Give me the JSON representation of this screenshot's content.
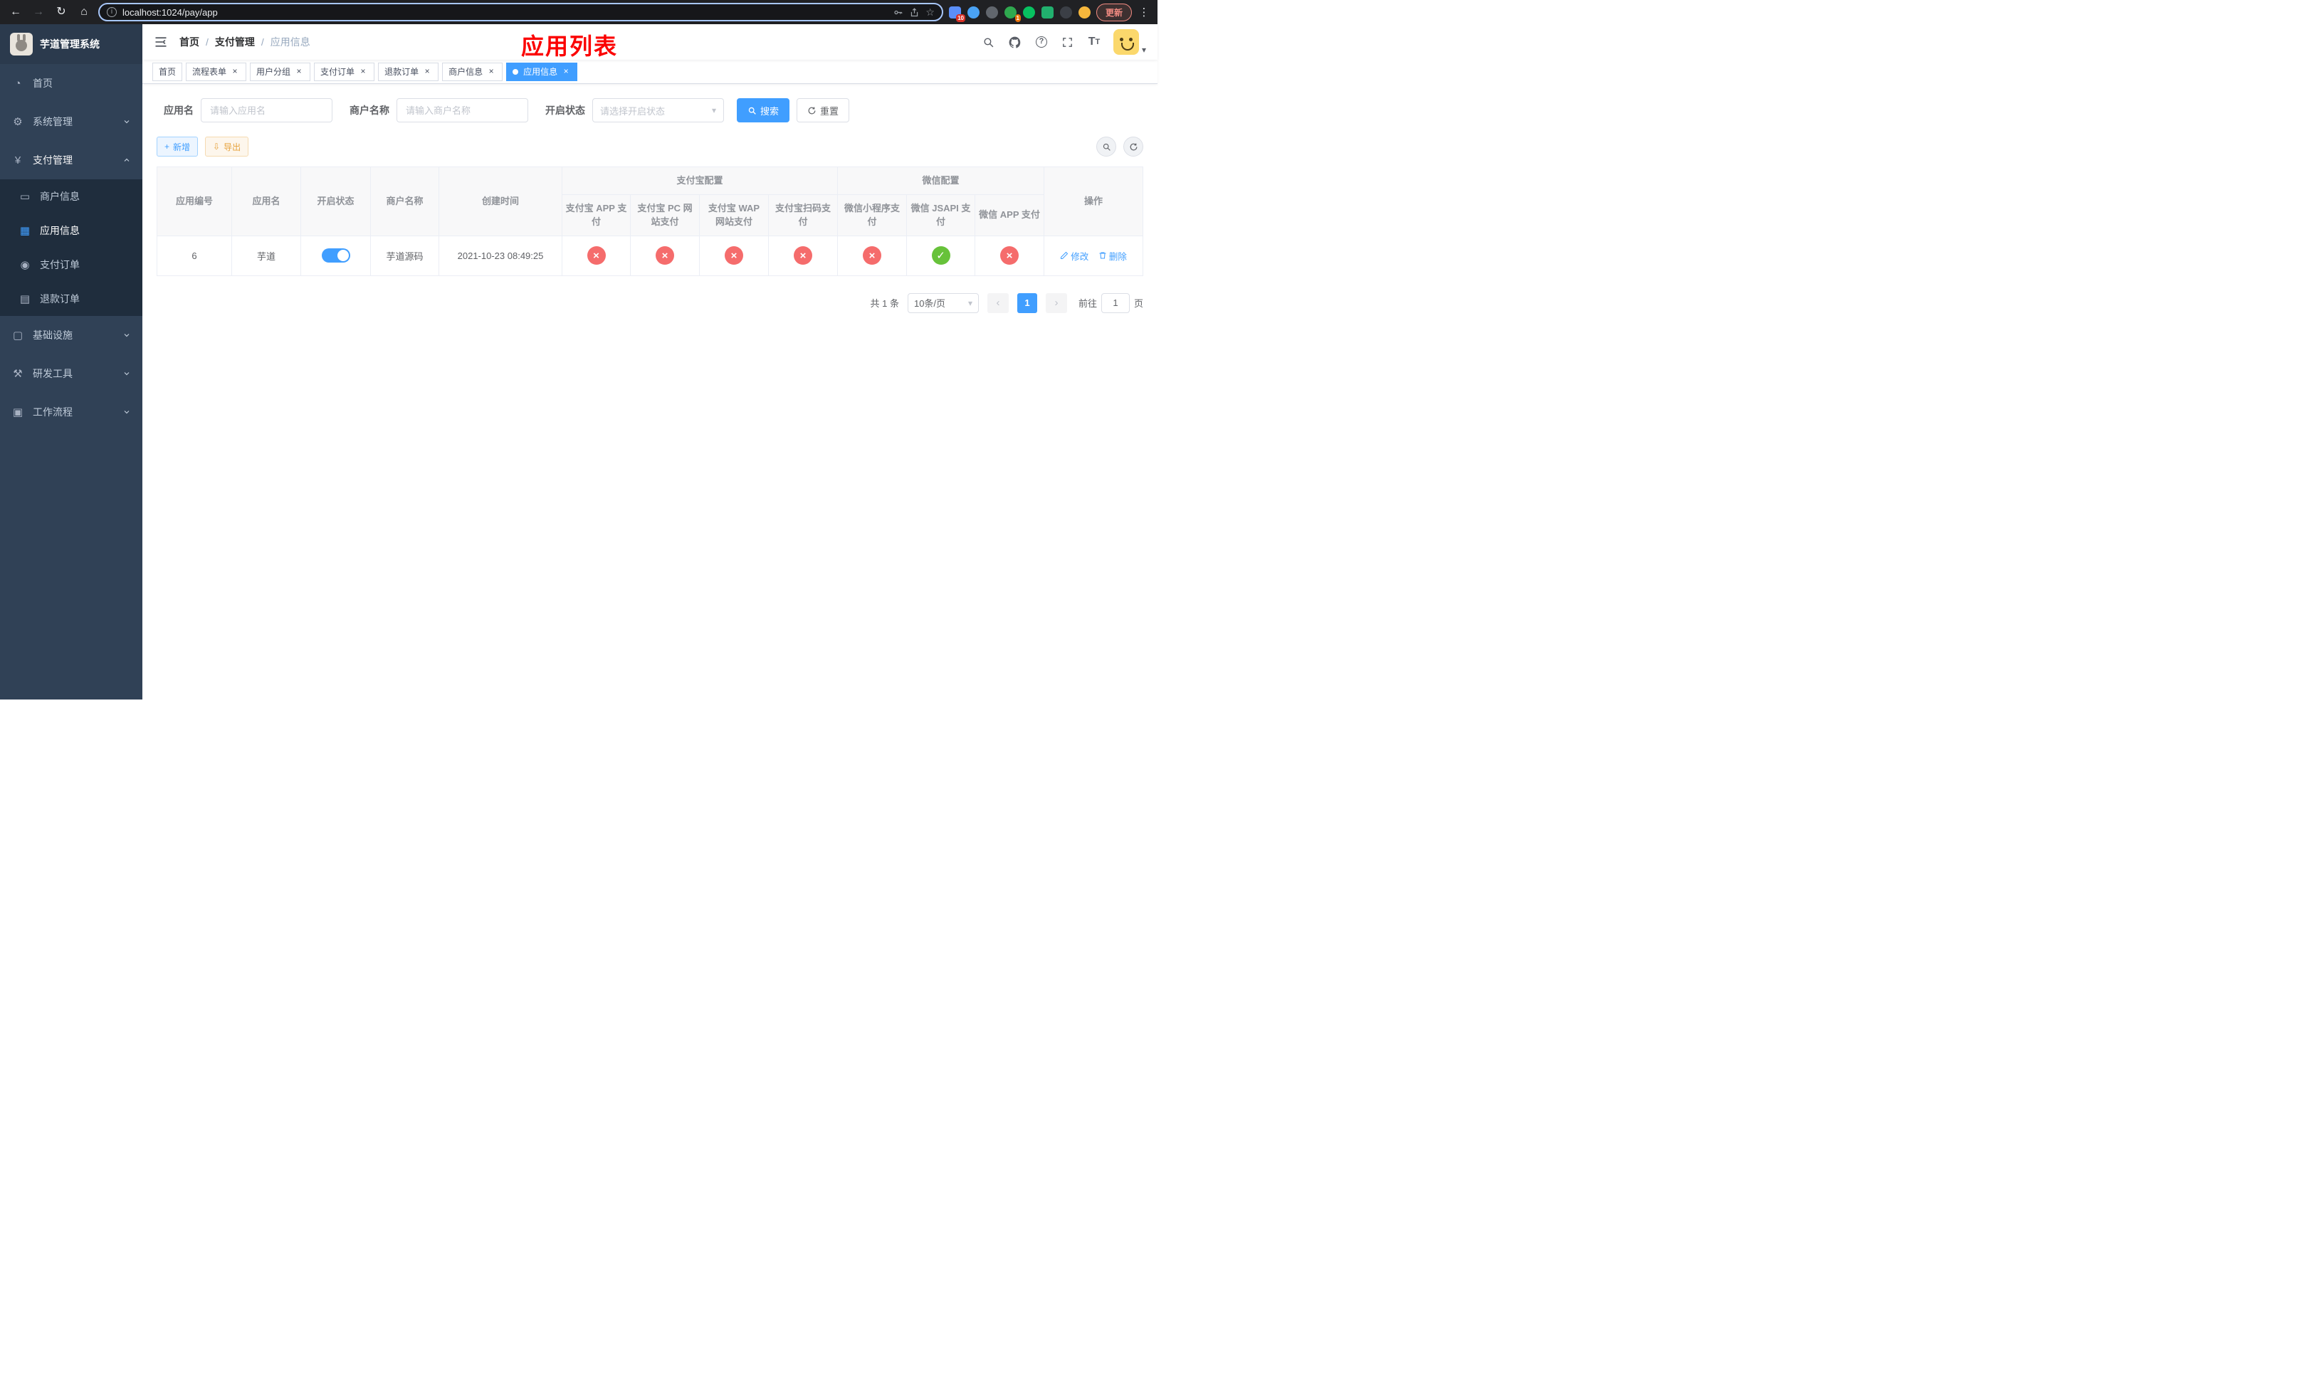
{
  "browser": {
    "url": "localhost:1024/pay/app",
    "update_label": "更新",
    "ext_badge_1": "10",
    "ext_badge_2": "1"
  },
  "icons": {
    "back": "←",
    "forward": "→",
    "reload": "↻",
    "home": "⌂",
    "star": "☆",
    "menu_dots": "⋮",
    "gear": "⚙",
    "yen": "¥",
    "dashboard": "◔",
    "card": "▭",
    "grid": "▦",
    "order": "◉",
    "doc": "▤",
    "infra": "▢",
    "tools": "⚒",
    "workflow": "▣",
    "caret_down": "▾",
    "plus": "+",
    "download": "⇩",
    "check": "✓",
    "cross": "×",
    "prev": "‹",
    "next": "›",
    "info": "i",
    "help": "?"
  },
  "sidebar": {
    "title": "芋道管理系统",
    "items": {
      "home": "首页",
      "system": "系统管理",
      "payment": "支付管理",
      "merchant": "商户信息",
      "app": "应用信息",
      "pay_order": "支付订单",
      "refund_order": "退款订单",
      "infra": "基础设施",
      "devtools": "研发工具",
      "workflow": "工作流程"
    }
  },
  "header": {
    "breadcrumb": [
      "首页",
      "支付管理",
      "应用信息"
    ],
    "annotation": "应用列表",
    "font_icon_big": "T",
    "font_icon_small": "T"
  },
  "tabs": [
    {
      "label": "首页"
    },
    {
      "label": "流程表单"
    },
    {
      "label": "用户分组"
    },
    {
      "label": "支付订单"
    },
    {
      "label": "退款订单"
    },
    {
      "label": "商户信息"
    },
    {
      "label": "应用信息"
    }
  ],
  "filters": {
    "app_name_label": "应用名",
    "app_name_placeholder": "请输入应用名",
    "merchant_label": "商户名称",
    "merchant_placeholder": "请输入商户名称",
    "status_label": "开启状态",
    "status_placeholder": "请选择开启状态",
    "search_label": "搜索",
    "reset_label": "重置"
  },
  "toolbar": {
    "add_label": "新增",
    "export_label": "导出"
  },
  "table": {
    "group_alipay": "支付宝配置",
    "group_wechat": "微信配置",
    "col_app_id": "应用编号",
    "col_app_name": "应用名",
    "col_status": "开启状态",
    "col_merchant": "商户名称",
    "col_created": "创建时间",
    "col_actions": "操作",
    "sub_columns": [
      "支付宝 APP 支付",
      "支付宝 PC 网站支付",
      "支付宝 WAP 网站支付",
      "支付宝扫码支付",
      "微信小程序支付",
      "微信 JSAPI 支付",
      "微信 APP 支付"
    ],
    "rows": [
      {
        "id": "6",
        "name": "芋道",
        "enabled": true,
        "merchant": "芋道源码",
        "created": "2021-10-23 08:49:25",
        "statuses": [
          "no",
          "no",
          "no",
          "no",
          "no",
          "yes",
          "no"
        ],
        "edit_label": "修改",
        "delete_label": "删除"
      }
    ]
  },
  "pagination": {
    "total": "共 1 条",
    "page_size": "10条/页",
    "current_page": "1",
    "goto_label": "前往",
    "goto_value": "1",
    "goto_unit": "页"
  },
  "colors": {
    "primary": "#409eff",
    "success": "#67c23a",
    "danger": "#f56c6c",
    "warning": "#e6a23c",
    "sidebar_bg": "#304156",
    "submenu_bg": "#1f2d3d",
    "annotation": "#fb0000"
  }
}
